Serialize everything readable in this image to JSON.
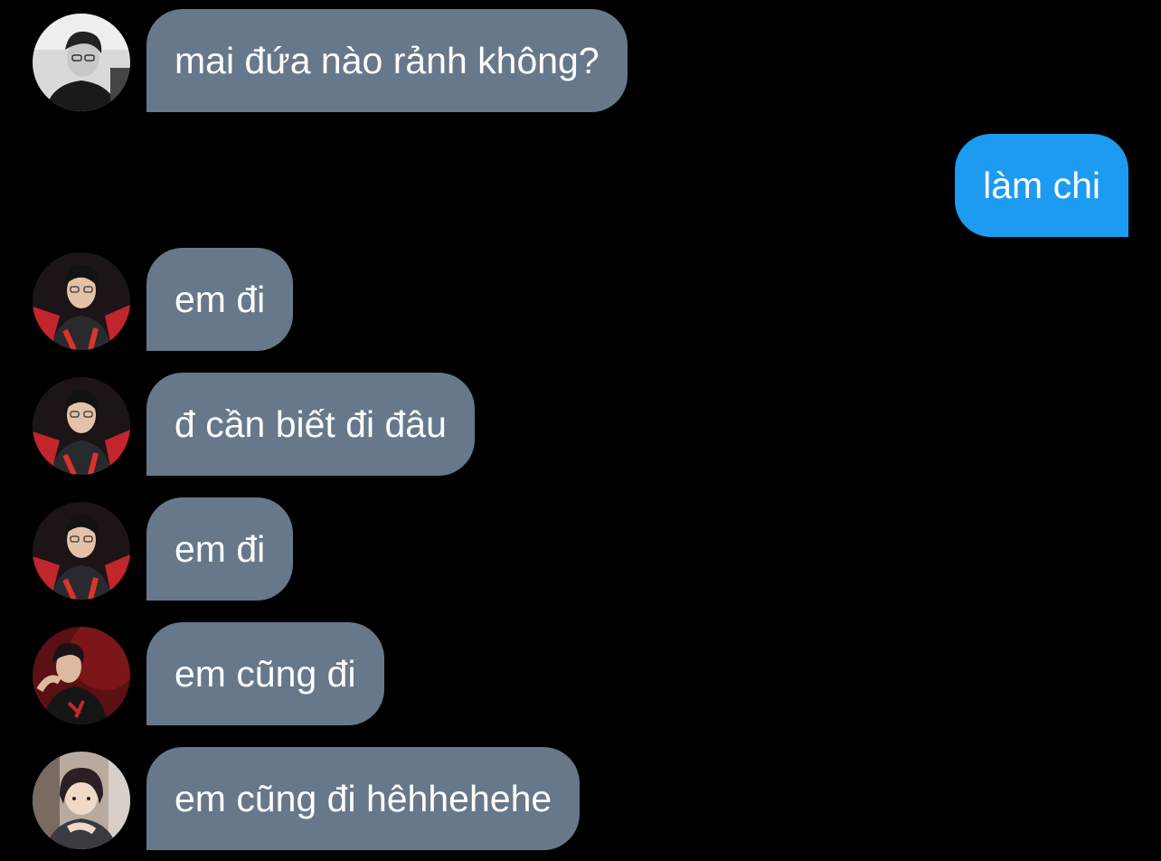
{
  "colors": {
    "background": "#000000",
    "incoming_bubble": "#66788a",
    "outgoing_bubble": "#1d9bf0",
    "text": "#ffffff"
  },
  "messages": [
    {
      "direction": "incoming",
      "text": "mai đứa nào rảnh không?",
      "avatar": "avatar-user-1"
    },
    {
      "direction": "outgoing",
      "text": "làm chi"
    },
    {
      "direction": "incoming",
      "text": "em đi",
      "avatar": "avatar-user-2"
    },
    {
      "direction": "incoming",
      "text": "đ cần biết đi đâu",
      "avatar": "avatar-user-2"
    },
    {
      "direction": "incoming",
      "text": "em đi",
      "avatar": "avatar-user-2"
    },
    {
      "direction": "incoming",
      "text": "em cũng đi",
      "avatar": "avatar-user-3"
    },
    {
      "direction": "incoming",
      "text": "em cũng đi hêhhehehe",
      "avatar": "avatar-user-4"
    }
  ]
}
